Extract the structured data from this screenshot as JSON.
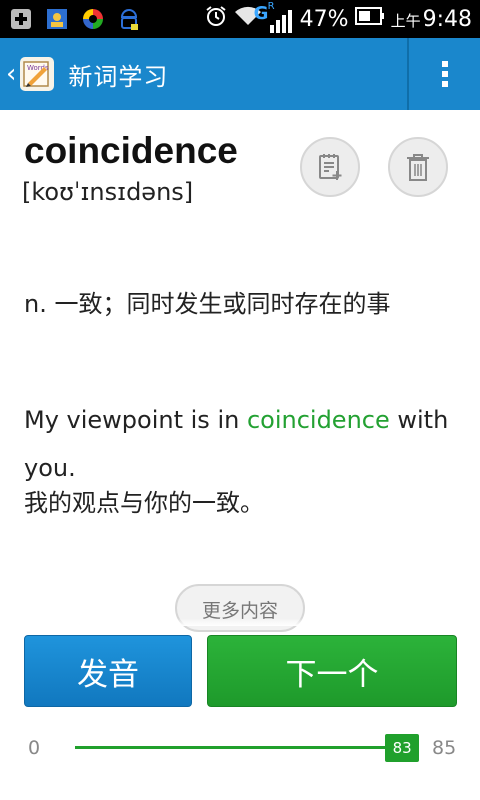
{
  "status_bar": {
    "battery": "47%",
    "time_prefix": "上午",
    "time": "9:48",
    "network": "G",
    "roaming": "R",
    "icons": [
      "add-icon",
      "contacts-icon",
      "app-icon",
      "android-icon",
      "alarm-icon",
      "wifi-icon",
      "signal-icon",
      "battery-icon"
    ]
  },
  "app_bar": {
    "title": "新词学习",
    "app_icon_text": "Words",
    "colors": {
      "background": "#1a87cc",
      "divider": "#0f6ea9"
    }
  },
  "word": {
    "term": "coincidence",
    "phonetic": "[koʊˈɪnsɪdəns]",
    "definition": "n. 一致；同时发生或同时存在的事",
    "example": {
      "before": "My viewpoint is in ",
      "highlight": "coincidence",
      "after": " with you."
    },
    "translation": "我的观点与你的一致。",
    "highlight_color": "#23a132"
  },
  "actions": {
    "more": "更多内容",
    "pronounce": "发音",
    "next": "下一个"
  },
  "progress": {
    "min": "0",
    "max": "85",
    "current": "83",
    "value": 83,
    "total": 85
  }
}
